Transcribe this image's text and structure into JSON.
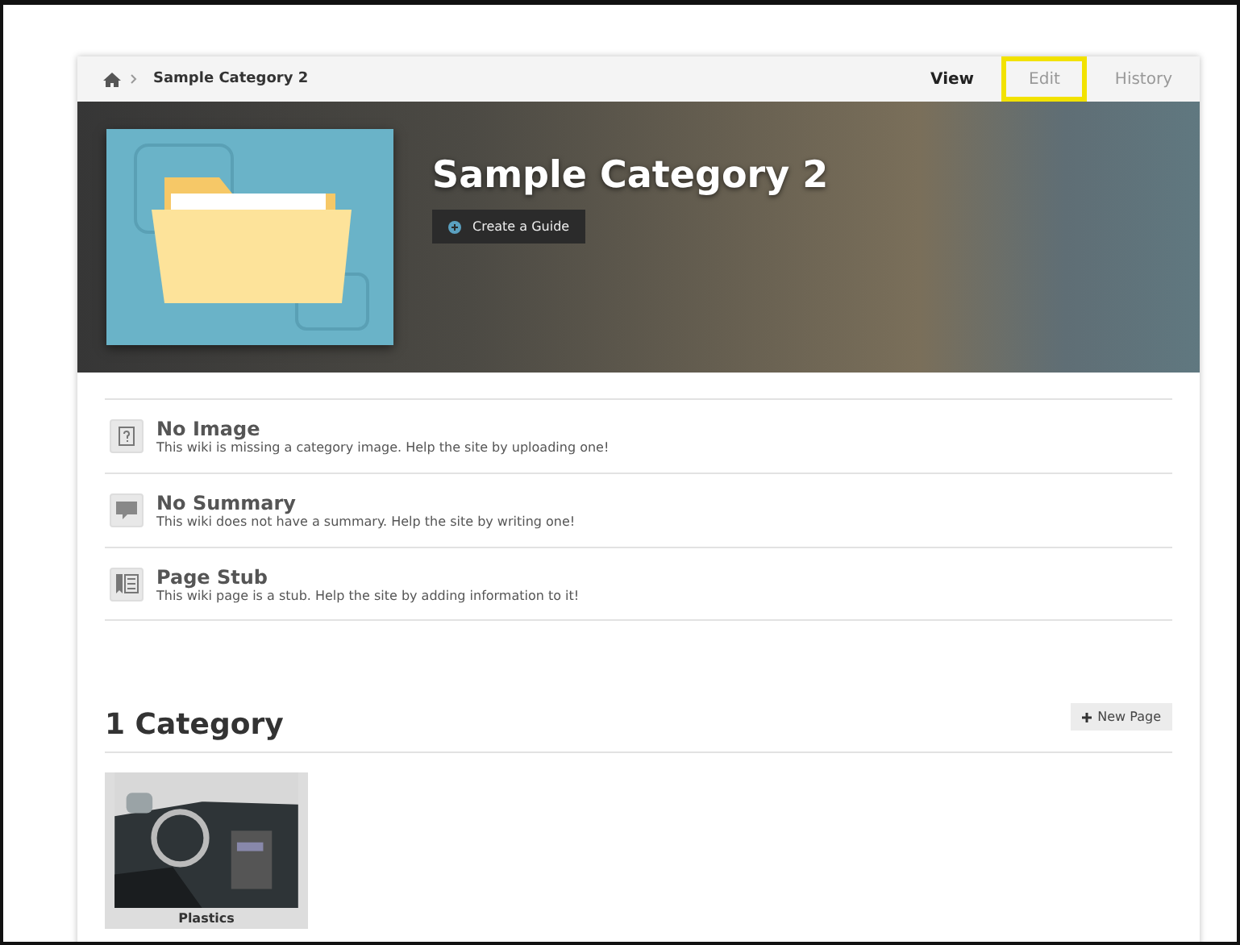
{
  "breadcrumb": {
    "current": "Sample Category 2"
  },
  "tabs": [
    {
      "label": "View",
      "selected": true,
      "highlighted": false
    },
    {
      "label": "Edit",
      "selected": false,
      "highlighted": true
    },
    {
      "label": "History",
      "selected": false,
      "highlighted": false
    }
  ],
  "hero": {
    "title": "Sample Category 2",
    "button": "Create a Guide"
  },
  "notices": [
    {
      "title": "No Image",
      "text": "This wiki is missing a category image. Help the site by uploading one!"
    },
    {
      "kind": "summary",
      "title": "No Summary",
      "text": "This wiki does not have a summary. Help the site by writing one!"
    },
    {
      "kind": "stub",
      "title": "Page Stub",
      "text": "This wiki page is a stub. Help the site by adding information to it!"
    }
  ],
  "categories": {
    "heading": "1 Category",
    "new_page_button": "New Page",
    "items": [
      {
        "label": "Plastics",
        "kind": "picture"
      }
    ]
  }
}
